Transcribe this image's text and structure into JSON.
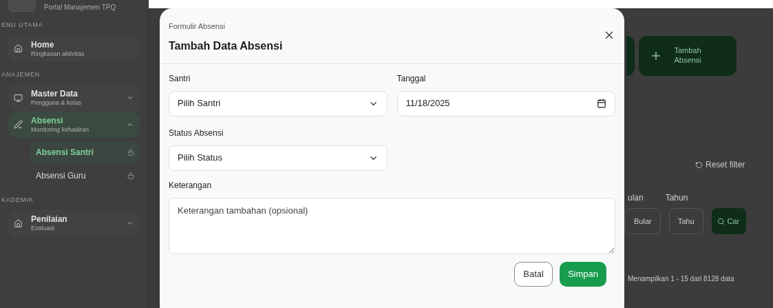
{
  "sidebar": {
    "brand": "Portal Manajemen TPQ",
    "sections": [
      {
        "heading": "ENU UTAMA",
        "items": [
          {
            "kind": "item",
            "title": "Home",
            "subtitle": "Ringkasan aktivitas",
            "selected": false
          }
        ]
      },
      {
        "heading": "ANAJEMEN",
        "items": [
          {
            "kind": "group",
            "title": "Master Data",
            "subtitle": "Pengguna & kelas",
            "selected": false,
            "expanded": false
          },
          {
            "kind": "group",
            "title": "Absensi",
            "subtitle": "Monitoring kehadiran",
            "selected": true,
            "expanded": true,
            "children": [
              {
                "title": "Absensi Santri",
                "selected": true
              },
              {
                "title": "Absensi Guru",
                "selected": false
              }
            ]
          }
        ]
      },
      {
        "heading": "KADEMIK",
        "items": [
          {
            "kind": "group",
            "title": "Penilaian",
            "subtitle": "Evaluasi",
            "selected": false,
            "expanded": false
          }
        ]
      }
    ]
  },
  "background": {
    "add_button": "Tambah Absensi",
    "reset": "Reset filter",
    "filter_labels": [
      "ulan",
      "Tahun"
    ],
    "filter_values": [
      "Bular",
      "Tahu"
    ],
    "search_button": "Car",
    "summary": "Menampilkan 1 - 15 dari 8128 data"
  },
  "modal": {
    "eyebrow": "Formulir Absensi",
    "title": "Tambah Data Absensi",
    "fields": [
      {
        "kind": "select",
        "label": "Santri",
        "value": "Pilih Santri"
      },
      {
        "kind": "date",
        "label": "Tanggal",
        "value": "11/18/2025"
      },
      {
        "kind": "select",
        "label": "Status Absensi",
        "value": "Pilih Status"
      },
      {
        "kind": "textarea",
        "label": "Keterangan",
        "placeholder": "Keterangan tambahan (opsional)"
      }
    ],
    "buttons": [
      {
        "label": "Batal",
        "kind": "secondary"
      },
      {
        "label": "Simpan",
        "kind": "primary"
      }
    ]
  }
}
